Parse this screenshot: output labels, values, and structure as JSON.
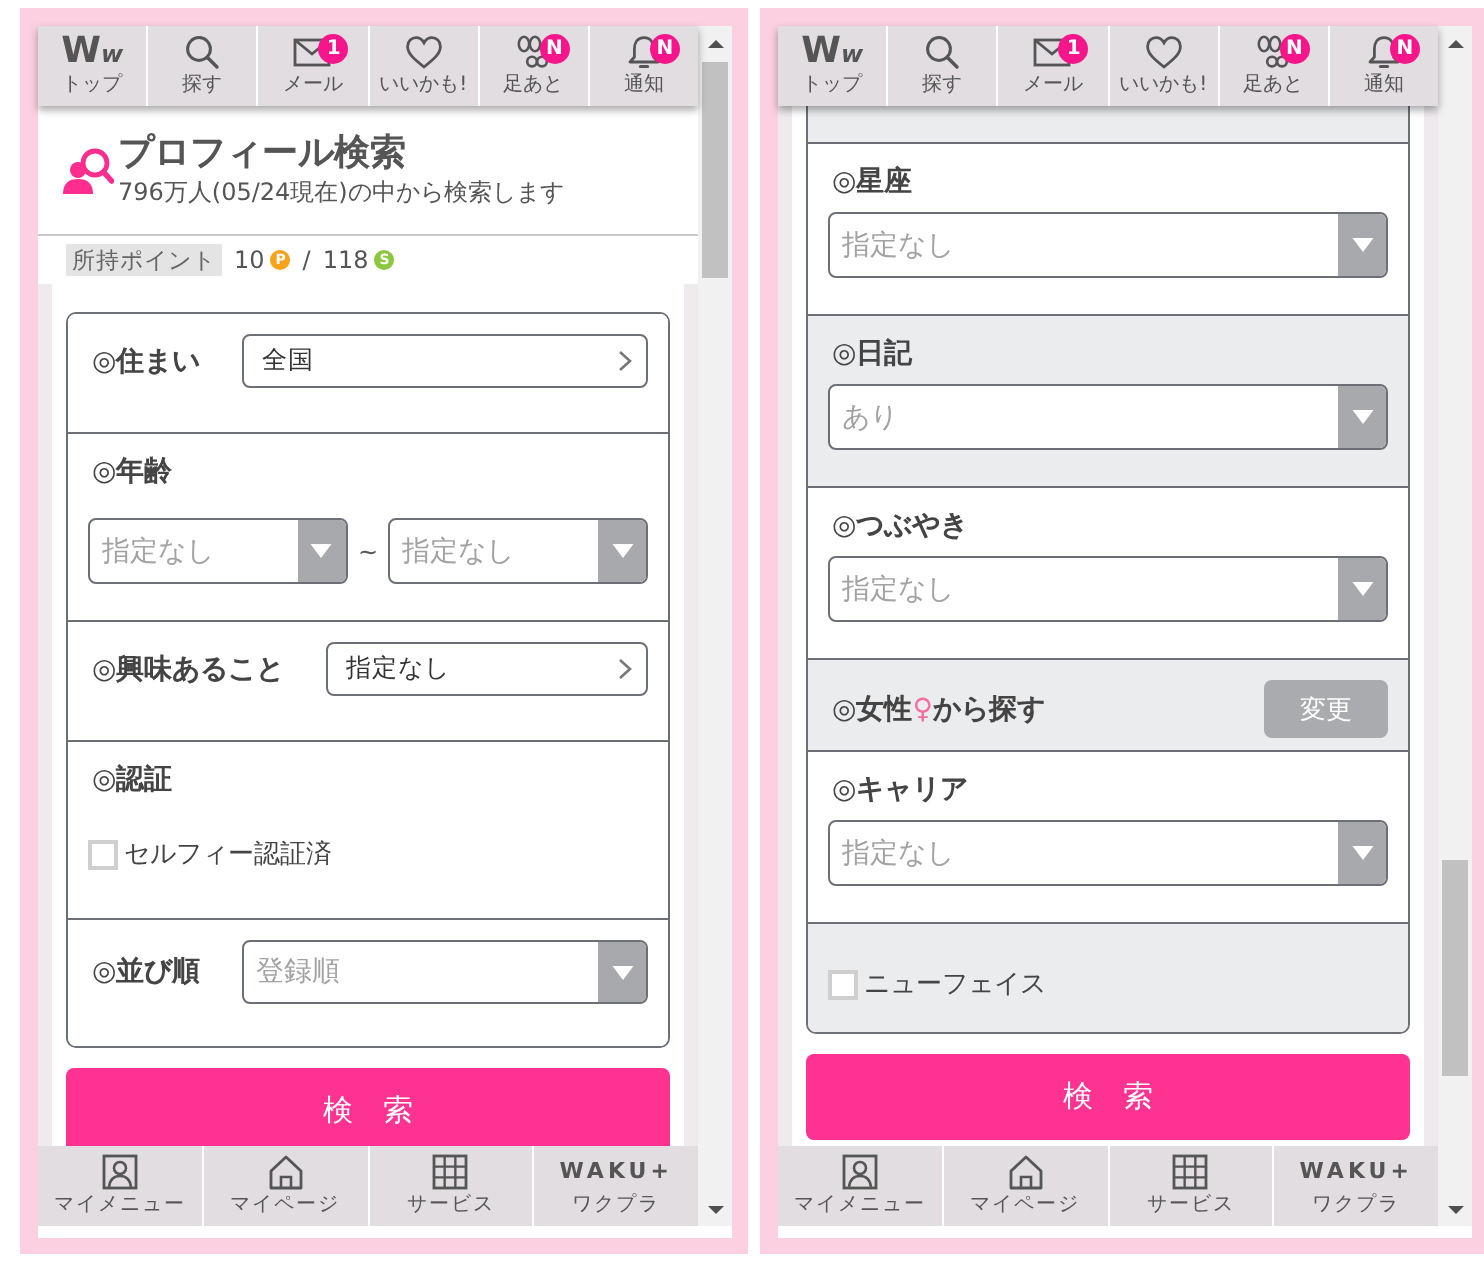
{
  "screens": [
    {
      "top_nav": [
        {
          "label": "トップ",
          "logo": "Ww"
        },
        {
          "label": "探す"
        },
        {
          "label": "メール",
          "badge": "1"
        },
        {
          "label": "いいかも!"
        },
        {
          "label": "足あと",
          "badge": "N"
        },
        {
          "label": "通知",
          "badge": "N"
        }
      ],
      "header": {
        "title": "プロフィール検索",
        "subtitle": "796万人(05/24現在)の中から検索します"
      },
      "points": {
        "label": "所持ポイント",
        "balances": [
          {
            "amount": "10",
            "unit": "P",
            "color": "#f7a21b"
          },
          {
            "amount": "118",
            "unit": "S",
            "color": "#8dc63f"
          }
        ],
        "separator": "/"
      },
      "form": {
        "sections": [
          {
            "kind": "picker",
            "label": "◎住まい",
            "value": "全国",
            "shaded": false
          },
          {
            "kind": "range",
            "label": "◎年齢",
            "from": "指定なし",
            "separator": "~",
            "to": "指定なし",
            "shaded": false
          },
          {
            "kind": "picker",
            "label": "◎興味あること",
            "value": "指定なし",
            "shaded": false
          },
          {
            "kind": "checkbox",
            "label": "◎認証",
            "option": "セルフィー認証済",
            "checked": false,
            "shaded": false
          },
          {
            "kind": "select",
            "label": "◎並び順",
            "value": "登録順",
            "inline": true,
            "shaded": false
          }
        ]
      },
      "search_button": "検　索",
      "bottom_nav": [
        {
          "label": "マイメニュー"
        },
        {
          "label": "マイページ"
        },
        {
          "label": "サービス"
        },
        {
          "label": "ワクプラ",
          "logo": "WAKU+"
        }
      ],
      "scrolled": false
    },
    {
      "top_nav": [
        {
          "label": "トップ",
          "logo": "Ww"
        },
        {
          "label": "探す"
        },
        {
          "label": "メール",
          "badge": "1"
        },
        {
          "label": "いいかも!"
        },
        {
          "label": "足あと",
          "badge": "N"
        },
        {
          "label": "通知",
          "badge": "N"
        }
      ],
      "form": {
        "sections": [
          {
            "kind": "fragment",
            "shaded": true
          },
          {
            "kind": "select",
            "label": "◎星座",
            "value": "指定なし",
            "inline": false,
            "shaded": false
          },
          {
            "kind": "select",
            "label": "◎日記",
            "value": "あり",
            "inline": false,
            "shaded": true
          },
          {
            "kind": "select",
            "label": "◎つぶやき",
            "value": "指定なし",
            "inline": false,
            "shaded": false
          },
          {
            "kind": "button",
            "label_parts": [
              {
                "text": "◎女性",
                "highlight": false
              },
              {
                "text": "♀",
                "highlight": true
              },
              {
                "text": "から探す",
                "highlight": false
              }
            ],
            "button": "変更",
            "shaded": true
          },
          {
            "kind": "select",
            "label": "◎キャリア",
            "value": "指定なし",
            "inline": false,
            "shaded": false
          },
          {
            "kind": "checkbox",
            "option": "ニューフェイス",
            "checked": false,
            "shaded": true
          }
        ]
      },
      "search_button": "検　索",
      "bottom_nav": [
        {
          "label": "マイメニュー"
        },
        {
          "label": "マイページ"
        },
        {
          "label": "サービス"
        },
        {
          "label": "ワクプラ",
          "logo": "WAKU+"
        }
      ],
      "scrolled": true
    }
  ]
}
